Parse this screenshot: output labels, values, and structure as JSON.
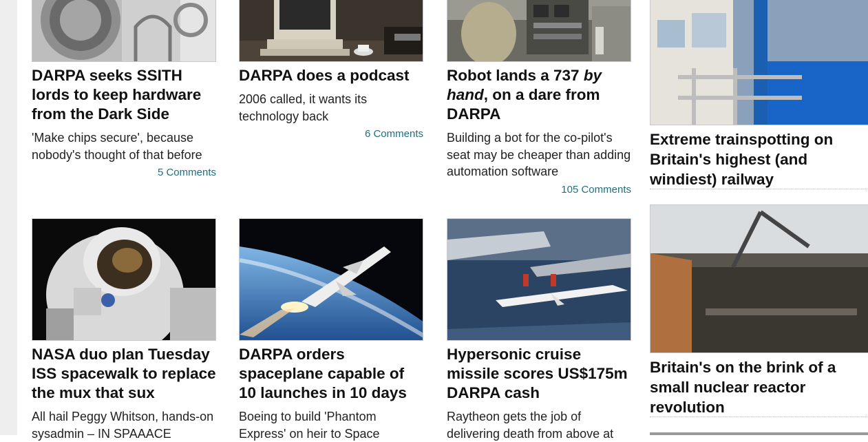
{
  "row1": [
    {
      "headline": "DARPA seeks SSITH lords to keep hardware from the Dark Side",
      "standfirst": "'Make chips secure', because nobody's thought of that before",
      "comments": "5 Comments",
      "image_icon": "vault-door-image"
    },
    {
      "headline": "DARPA does a podcast",
      "standfirst": "2006 called, it wants its technology back",
      "comments": "6 Comments",
      "image_icon": "retro-computer-image"
    },
    {
      "headline_pre": "Robot lands a 737 ",
      "headline_em": "by hand",
      "headline_post": ", on a dare from DARPA",
      "standfirst": "Building a bot for the co-pilot's seat may be cheaper than adding automation software",
      "comments": "105 Comments",
      "image_icon": "cockpit-image"
    }
  ],
  "row2": [
    {
      "headline": "NASA duo plan Tuesday ISS spacewalk to replace the mux that sux",
      "standfirst": "All hail Peggy Whitson, hands-on sysadmin – IN SPAAACE",
      "image_icon": "astronaut-image"
    },
    {
      "headline": "DARPA orders spaceplane capable of 10 launches in 10 days",
      "standfirst": "Boeing to build 'Phantom Express' on heir to Space",
      "image_icon": "spaceplane-image"
    },
    {
      "headline": "Hypersonic cruise missile scores US$175m DARPA cash",
      "standfirst": "Raytheon gets the job of delivering death from above at",
      "image_icon": "missile-image"
    }
  ],
  "sidebar": [
    {
      "headline": "Extreme trainspotting on Britain's highest (and windiest) railway",
      "image_icon": "railway-carriage-image"
    },
    {
      "headline": "Britain's on the brink of a small nuclear reactor revolution",
      "image_icon": "construction-site-image"
    }
  ],
  "colors": {
    "link": "#1f6f7e",
    "gutter": "#eeeeee",
    "border": "#c9c9c9"
  }
}
